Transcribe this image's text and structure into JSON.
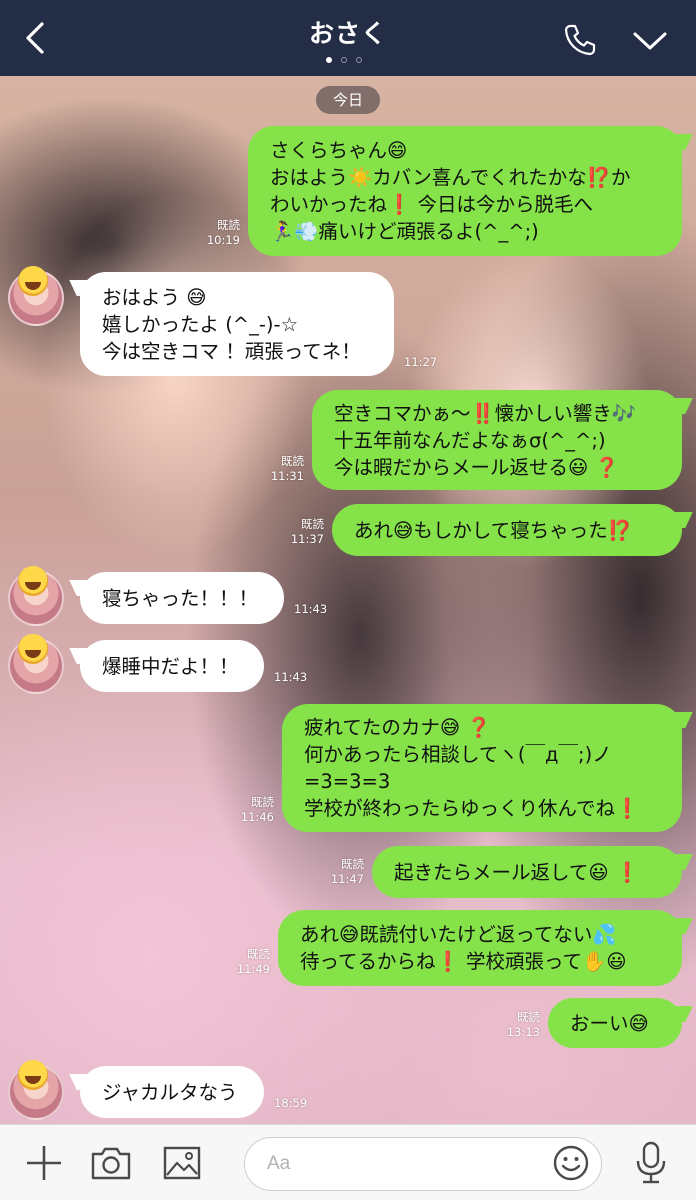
{
  "header": {
    "title": "おさく",
    "back_icon": "back-chevron-icon",
    "call_icon": "phone-icon",
    "menu_icon": "chevron-down-icon"
  },
  "date_chip": "今日",
  "messages": [
    {
      "side": "out",
      "text": "さくらちゃん😄\nおはよう☀️カバン喜んでくれたかな⁉️か\nわいかったね❗ 今日は今から脱毛へ\n🏃‍♀️💨痛いけど頑張るよ(^_^;)",
      "read": "既読",
      "time": "10:19"
    },
    {
      "side": "in",
      "text": "おはよう 😅\n嬉しかったよ (^_-)-☆\n今は空きコマ ！頑張ってネ！",
      "time": "11:27"
    },
    {
      "side": "out",
      "text": "空きコマかぁ〜‼️懐かしい響き🎶\n十五年前なんだよなぁσ(^_^;)\n今は暇だからメール返せる😃 ❓",
      "read": "既読",
      "time": "11:31"
    },
    {
      "side": "out",
      "text": "あれ😅もしかして寝ちゃった⁉️",
      "read": "既読",
      "time": "11:37"
    },
    {
      "side": "in",
      "text": "寝ちゃった！！！",
      "time": "11:43"
    },
    {
      "side": "in",
      "text": "爆睡中だよ！！",
      "time": "11:43"
    },
    {
      "side": "out",
      "text": "疲れてたのカナ😅 ❓\n何かあったら相談してヽ(￣д￣;)ノ\n=3=3=3\n学校が終わったらゆっくり休んでね❗",
      "read": "既読",
      "time": "11:46"
    },
    {
      "side": "out",
      "text": "起きたらメール返して😃 ❗",
      "read": "既読",
      "time": "11:47"
    },
    {
      "side": "out",
      "text": "あれ😅既読付いたけど返ってない💦\n待ってるからね❗ 学校頑張って✋😃",
      "read": "既読",
      "time": "11:49"
    },
    {
      "side": "out",
      "text": "おーい😅",
      "read": "既読",
      "time": "13:13"
    },
    {
      "side": "in",
      "text": "ジャカルタなう",
      "time": "18:59"
    }
  ],
  "input": {
    "placeholder": "Aa"
  },
  "toolbar": {
    "plus_icon": "plus-icon",
    "camera_icon": "camera-icon",
    "image_icon": "image-icon",
    "emoji_icon": "smiley-icon",
    "mic_icon": "microphone-icon"
  },
  "colors": {
    "header_bg": "#232d45",
    "out_bubble": "#85e249",
    "in_bubble": "#ffffff",
    "bottom_bar": "#f7f7f7"
  }
}
